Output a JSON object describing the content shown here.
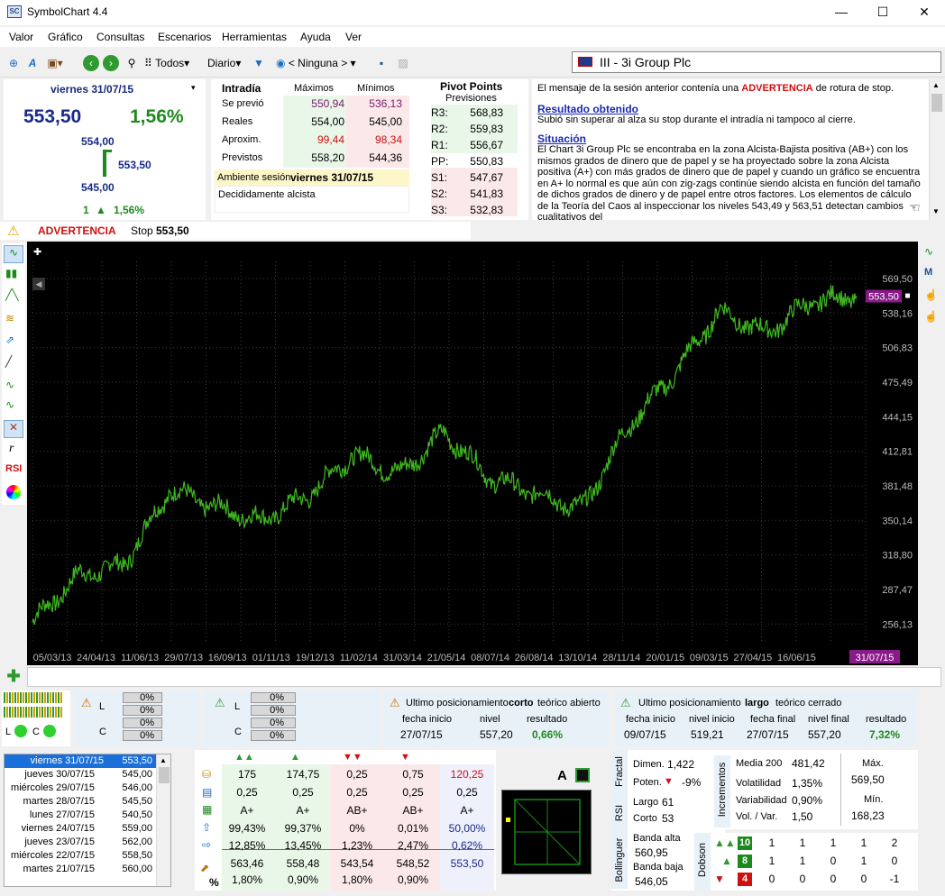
{
  "window": {
    "title": "SymbolChart 4.4",
    "logo": "SC",
    "minimize": "—",
    "maximize": "☐",
    "close": "✕"
  },
  "menu": [
    "Valor",
    "Gráfico",
    "Consultas",
    "Escenarios",
    "Herramientas",
    "Ayuda",
    "Ver"
  ],
  "toolbar": {
    "filter_all": "Todos",
    "period": "Diario",
    "view": "< Ninguna >"
  },
  "symbol": {
    "flag": "uk-flag-icon",
    "text": "III - 3i Group Plc"
  },
  "quote": {
    "date": "viernes 31/07/15",
    "price": "553,50",
    "change_pct": "1,56%",
    "high": "554,00",
    "last": "553,50",
    "low": "545,00",
    "count": "1",
    "change_small": "1,56%"
  },
  "intraday": {
    "title": "Intradía",
    "col_max": "Máximos",
    "col_min": "Mínimos",
    "rows": [
      {
        "label": "Se previó",
        "max": "550,94",
        "min": "536,13"
      },
      {
        "label": "Reales",
        "max": "554,00",
        "min": "545,00"
      },
      {
        "label": "Aproxim.",
        "max": "99,44",
        "min": "98,34"
      },
      {
        "label": "Previstos",
        "max": "558,20",
        "min": "544,36"
      }
    ],
    "ambiente_label": "Ambiente sesión",
    "ambiente_date": "viernes 31/07/15",
    "ambiente_text": "Decididamente alcista"
  },
  "pivot": {
    "title": "Pivot Points",
    "subtitle": "Previsiones",
    "rows": [
      {
        "k": "R3:",
        "v": "568,83"
      },
      {
        "k": "R2:",
        "v": "559,83"
      },
      {
        "k": "R1:",
        "v": "556,67"
      },
      {
        "k": "PP:",
        "v": "550,83"
      },
      {
        "k": "S1:",
        "v": "547,67"
      },
      {
        "k": "S2:",
        "v": "541,83"
      },
      {
        "k": "S3:",
        "v": "532,83"
      }
    ]
  },
  "message": {
    "intro_a": "El mensaje de la sesión anterior contenía una",
    "intro_warn": "ADVERTENCIA",
    "intro_b": "de rotura de stop.",
    "h1": "Resultado obtenido",
    "p1": "Subió sin superar al alza su stop durante el intradía ni tampoco al cierre.",
    "h2": "Situación",
    "p2": "El Chart 3i Group Plc se encontraba en la zona Alcista-Bajista positiva (AB+) con los mismos grados de dinero que de papel y se ha proyectado sobre la zona Alcista positiva (A+) con más grados de dinero que de papel y cuando un gráfico se encuentra en A+ lo normal es que aún con zig-zags continúe siendo alcista en función del tamaño de dichos grados de dinero y de papel entre otros factores. Los elementos de cálculo de la Teoría del Caos al inspeccionar los niveles 543,49 y 563,51 detectan cambios cualitativos del"
  },
  "alert": {
    "label": "ADVERTENCIA",
    "stop_label": "Stop",
    "stop_value": "553,50"
  },
  "chart_data": {
    "type": "line",
    "title": "",
    "xlabel": "",
    "ylabel": "",
    "x": [
      "05/03/13",
      "24/04/13",
      "11/06/13",
      "29/07/13",
      "16/09/13",
      "01/11/13",
      "19/12/13",
      "11/02/14",
      "31/03/14",
      "21/05/14",
      "08/07/14",
      "26/08/14",
      "13/10/14",
      "28/11/14",
      "20/01/15",
      "09/03/15",
      "27/04/15",
      "16/06/15",
      "31/07/15"
    ],
    "values": [
      258,
      300,
      310,
      378,
      362,
      350,
      372,
      410,
      392,
      430,
      388,
      375,
      360,
      435,
      482,
      540,
      520,
      548,
      553.5
    ],
    "y_ticks": [
      "569,50",
      "538,16",
      "506,83",
      "475,49",
      "444,15",
      "412,81",
      "381,48",
      "350,14",
      "318,80",
      "287,47",
      "256,13"
    ],
    "ylim": [
      240,
      585
    ],
    "last_label": "553,50",
    "last_date": "31/07/15",
    "line_color": "#3fb820",
    "grid": true
  },
  "positions": {
    "short_title_a": "Ultimo posicionamiento",
    "short_title_b": "corto",
    "short_title_c": "teórico abierto",
    "short_cols": [
      "fecha inicio",
      "nivel",
      "resultado"
    ],
    "short_vals": [
      "27/07/15",
      "557,20",
      "0,66%"
    ],
    "long_title_a": "Ultimo posicionamiento",
    "long_title_b": "largo",
    "long_title_c": "teórico cerrado",
    "long_cols": [
      "fecha inicio",
      "nivel inicio",
      "fecha final",
      "nivel final",
      "resultado"
    ],
    "long_vals": [
      "09/07/15",
      "519,21",
      "27/07/15",
      "557,20",
      "7,32%"
    ]
  },
  "gauges": {
    "L": "L",
    "C": "C",
    "pct": "0%"
  },
  "history": [
    {
      "d": "viernes 31/07/15",
      "v": "553,50"
    },
    {
      "d": "jueves 30/07/15",
      "v": "545,00"
    },
    {
      "d": "miércoles 29/07/15",
      "v": "546,00"
    },
    {
      "d": "martes 28/07/15",
      "v": "545,50"
    },
    {
      "d": "lunes 27/07/15",
      "v": "540,50"
    },
    {
      "d": "viernes 24/07/15",
      "v": "559,00"
    },
    {
      "d": "jueves 23/07/15",
      "v": "562,00"
    },
    {
      "d": "miércoles 22/07/15",
      "v": "558,50"
    },
    {
      "d": "martes 21/07/15",
      "v": "560,00"
    }
  ],
  "grid": {
    "rows": [
      [
        "175",
        "174,75",
        "0,25",
        "0,75",
        "120,25"
      ],
      [
        "0,25",
        "0,25",
        "0,25",
        "0,25",
        "0,25"
      ],
      [
        "A+",
        "A+",
        "AB+",
        "AB+",
        "A+"
      ],
      [
        "99,43%",
        "99,37%",
        "0%",
        "0,01%",
        "50,00%"
      ],
      [
        "12,85%",
        "13,45%",
        "1,23%",
        "2,47%",
        "0,62%"
      ],
      [
        "563,46",
        "558,48",
        "543,54",
        "548,52",
        "553,50"
      ],
      [
        "1,80%",
        "0,90%",
        "1,80%",
        "0,90%",
        ""
      ]
    ],
    "zone_label": "A",
    "pct_sym": "%"
  },
  "fractal": {
    "label": "Fractal",
    "dimen_label": "Dimen.",
    "dimen": "1,422",
    "poten_label": "Poten.",
    "poten": "-9%"
  },
  "rsi": {
    "label": "RSI",
    "largo_label": "Largo",
    "largo": "61",
    "corto_label": "Corto",
    "corto": "53"
  },
  "bollinger": {
    "label": "Bollinguer",
    "alta_label": "Banda alta",
    "alta": "560,95",
    "baja_label": "Banda baja",
    "baja": "546,05"
  },
  "incrementos": {
    "label": "Incrementos",
    "rows": [
      {
        "k": "Media 200",
        "v": "481,42"
      },
      {
        "k": "Volatilidad",
        "v": "1,35%"
      },
      {
        "k": "Variabilidad",
        "v": "0,90%"
      },
      {
        "k": "Vol. / Var.",
        "v": "1,50"
      }
    ],
    "max_label": "Máx.",
    "max": "569,50",
    "min_label": "Mín.",
    "min": "168,23"
  },
  "dobson": {
    "label": "Dobson",
    "rows": [
      {
        "n": "10",
        "vals": [
          "1",
          "1",
          "1",
          "1",
          "2"
        ]
      },
      {
        "n": "8",
        "vals": [
          "1",
          "1",
          "0",
          "1",
          "0"
        ]
      },
      {
        "n": "4",
        "vals": [
          "0",
          "0",
          "0",
          "0",
          "-1"
        ]
      }
    ]
  }
}
